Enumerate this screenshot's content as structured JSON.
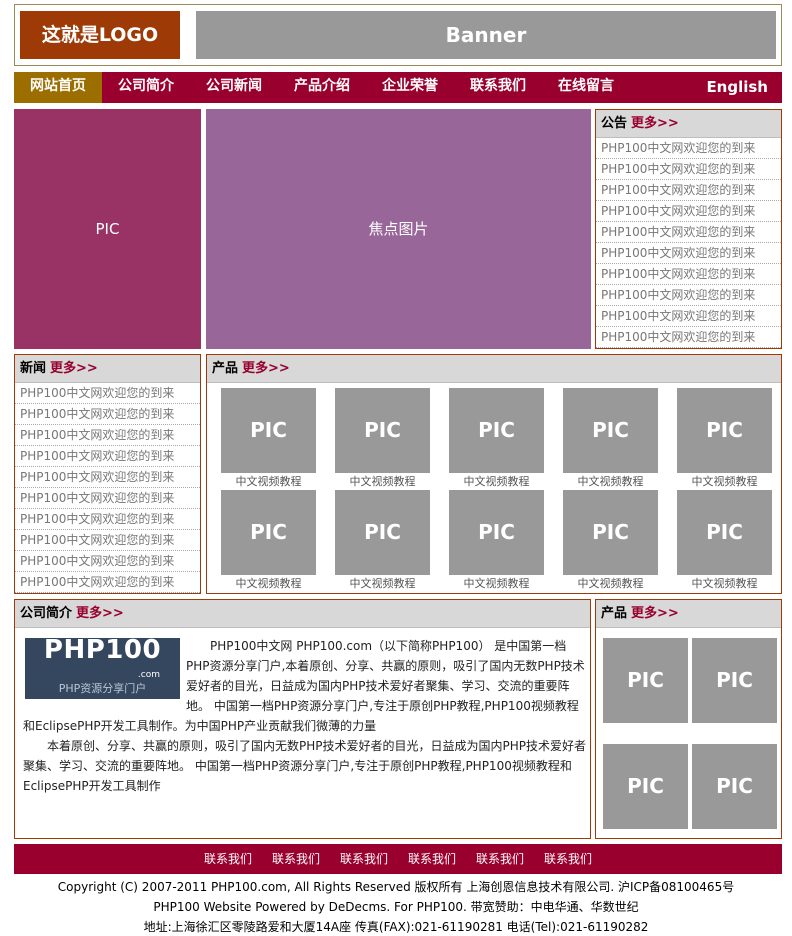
{
  "header": {
    "logo": "这就是LOGO",
    "banner": "Banner"
  },
  "nav": {
    "items": [
      "网站首页",
      "公司简介",
      "公司新闻",
      "产品介绍",
      "企业荣誉",
      "联系我们",
      "在线留言"
    ],
    "english": "English"
  },
  "focus": {
    "left_pic": "PIC",
    "focus_pic": "焦点图片"
  },
  "notice": {
    "title": "公告",
    "more": "更多>>",
    "items": [
      "PHP100中文网欢迎您的到来",
      "PHP100中文网欢迎您的到来",
      "PHP100中文网欢迎您的到来",
      "PHP100中文网欢迎您的到来",
      "PHP100中文网欢迎您的到来",
      "PHP100中文网欢迎您的到来",
      "PHP100中文网欢迎您的到来",
      "PHP100中文网欢迎您的到来",
      "PHP100中文网欢迎您的到来",
      "PHP100中文网欢迎您的到来"
    ]
  },
  "news": {
    "title": "新闻",
    "more": "更多>>",
    "items": [
      "PHP100中文网欢迎您的到来",
      "PHP100中文网欢迎您的到来",
      "PHP100中文网欢迎您的到来",
      "PHP100中文网欢迎您的到来",
      "PHP100中文网欢迎您的到来",
      "PHP100中文网欢迎您的到来",
      "PHP100中文网欢迎您的到来",
      "PHP100中文网欢迎您的到来",
      "PHP100中文网欢迎您的到来",
      "PHP100中文网欢迎您的到来"
    ]
  },
  "products": {
    "title": "产品",
    "more": "更多>>",
    "items": [
      {
        "pic": "PIC",
        "caption": "中文视频教程"
      },
      {
        "pic": "PIC",
        "caption": "中文视频教程"
      },
      {
        "pic": "PIC",
        "caption": "中文视频教程"
      },
      {
        "pic": "PIC",
        "caption": "中文视频教程"
      },
      {
        "pic": "PIC",
        "caption": "中文视频教程"
      },
      {
        "pic": "PIC",
        "caption": "中文视频教程"
      },
      {
        "pic": "PIC",
        "caption": "中文视频教程"
      },
      {
        "pic": "PIC",
        "caption": "中文视频教程"
      },
      {
        "pic": "PIC",
        "caption": "中文视频教程"
      },
      {
        "pic": "PIC",
        "caption": "中文视频教程"
      }
    ]
  },
  "intro": {
    "title": "公司简介",
    "more": "更多>>",
    "logo_main": "PHP100",
    "logo_com": ".com",
    "logo_sub": "PHP资源分享门户",
    "p1": "PHP100中文网 PHP100.com（以下简称PHP100） 是中国第一档PHP资源分享门户,本着原创、分享、共赢的原则，吸引了国内无数PHP技术爱好者的目光，日益成为国内PHP技术爱好者聚集、学习、交流的重要阵地。 中国第一档PHP资源分享门户,专注于原创PHP教程,PHP100视频教程和EclipsePHP开发工具制作。为中国PHP产业贡献我们微薄的力量",
    "p2": "本着原创、分享、共赢的原则，吸引了国内无数PHP技术爱好者的目光，日益成为国内PHP技术爱好者聚集、学习、交流的重要阵地。 中国第一档PHP资源分享门户,专注于原创PHP教程,PHP100视频教程和EclipsePHP开发工具制作"
  },
  "side_products": {
    "title": "产品",
    "more": "更多>>",
    "items": [
      "PIC",
      "PIC",
      "PIC",
      "PIC"
    ]
  },
  "footer": {
    "links": [
      "联系我们",
      "联系我们",
      "联系我们",
      "联系我们",
      "联系我们",
      "联系我们"
    ],
    "copyright": "Copyright (C) 2007-2011 PHP100.com, All Rights Reserved 版权所有 上海创恩信息技术有限公司. 沪ICP备08100465号",
    "powered": "PHP100 Website Powered by DeDecms. For PHP100. 带宽赞助：中电华通、华数世纪",
    "address": "地址:上海徐汇区零陵路爱和大厦14A座 传真(FAX):021-61190281 电话(Tel):021-61190282"
  },
  "colors": {
    "brand": "#99002e",
    "nav_active": "#9c6e00",
    "logo_bg": "#9e3a06",
    "placeholder": "#999999",
    "pic_left": "#993366",
    "pic_focus": "#996699"
  }
}
